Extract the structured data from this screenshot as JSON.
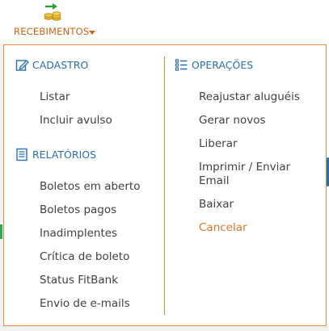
{
  "nav": {
    "label": "RECEBIMENTOS",
    "icon": "money-transfer-icon",
    "accent_color": "#c9621a"
  },
  "menu": {
    "border_color": "#e08a3c",
    "header_color": "#2a6ea8",
    "left": [
      {
        "title": "CADASTRO",
        "icon": "edit-icon",
        "items": [
          "Listar",
          "Incluir avulso"
        ]
      },
      {
        "title": "RELATÓRIOS",
        "icon": "report-icon",
        "items": [
          "Boletos em aberto",
          "Boletos pagos",
          "Inadimplentes",
          "Crítica de boleto",
          "Status FitBank",
          "Envio de e-mails"
        ]
      }
    ],
    "right": [
      {
        "title": "OPERAÇÕES",
        "icon": "list-icon",
        "items": [
          "Reajustar aluguéis",
          "Gerar novos",
          "Liberar",
          "Imprimir / Enviar Email",
          "Baixar",
          "Cancelar"
        ]
      }
    ]
  }
}
